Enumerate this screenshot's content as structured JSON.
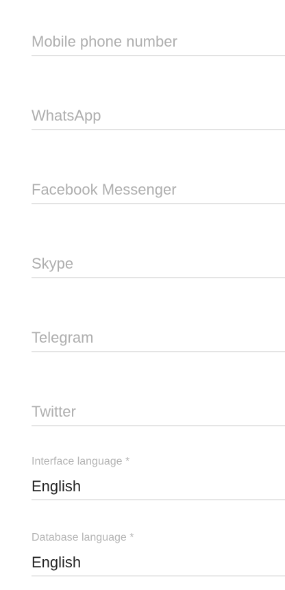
{
  "contact_fields": [
    {
      "placeholder": "Mobile phone number",
      "value": ""
    },
    {
      "placeholder": "WhatsApp",
      "value": ""
    },
    {
      "placeholder": "Facebook Messenger",
      "value": ""
    },
    {
      "placeholder": "Skype",
      "value": ""
    },
    {
      "placeholder": "Telegram",
      "value": ""
    },
    {
      "placeholder": "Twitter",
      "value": ""
    }
  ],
  "interface_language": {
    "label": "Interface language *",
    "value": "English"
  },
  "database_language": {
    "label": "Database language *",
    "value": "English"
  },
  "colors": {
    "placeholder": "#aeaeae",
    "underline": "#c4c4c4",
    "value_text": "#222222"
  }
}
